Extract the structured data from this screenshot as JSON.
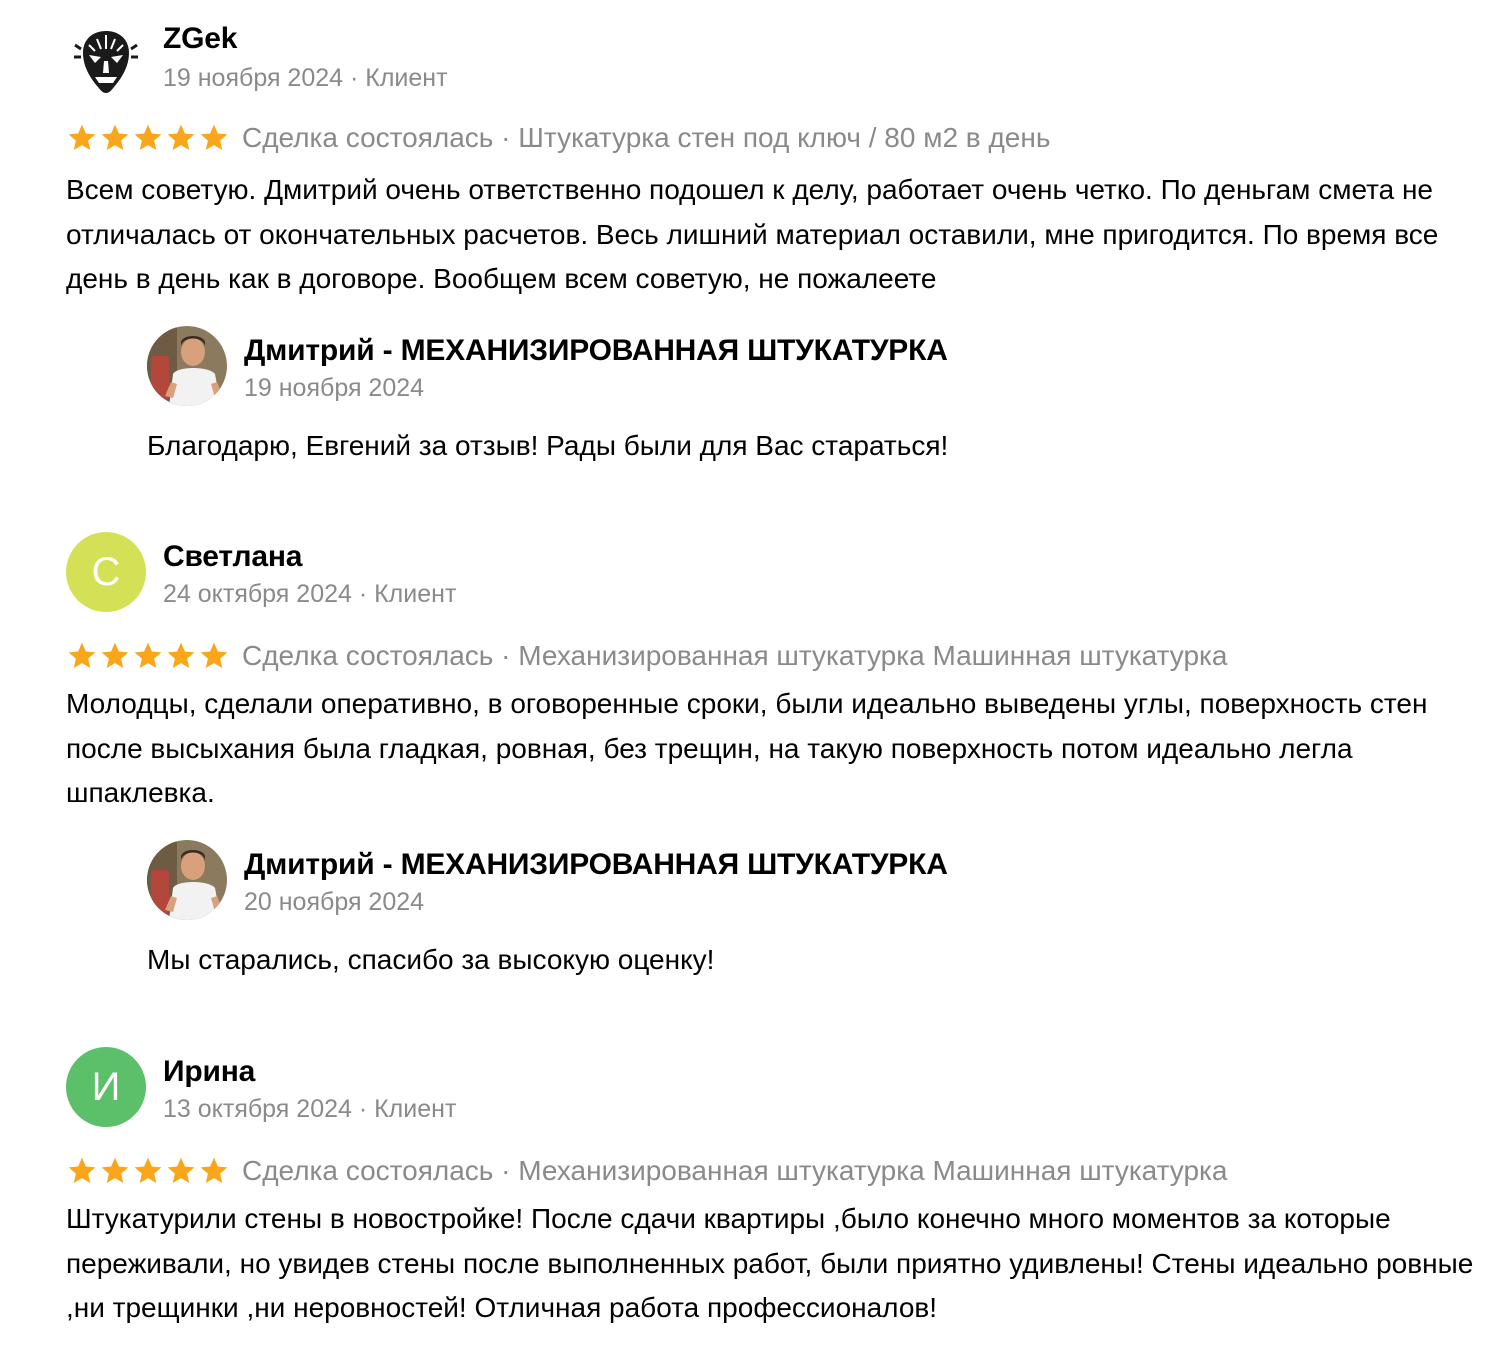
{
  "colors": {
    "star": "#f9a61a",
    "meta": "#8a8a8a",
    "avatar_svetlana": "#d4e157",
    "avatar_irina": "#5cbf6a"
  },
  "icons": {
    "star": "star-icon",
    "mask": "tribal-mask-icon",
    "person_photo": "owner-photo"
  },
  "reviews": [
    {
      "author": "ZGek",
      "meta": "19 ноября 2024 · Клиент",
      "rating": 5,
      "deal": "Сделка состоялась · Штукатурка стен под ключ / 80 м2 в день",
      "text": "Всем советую. Дмитрий очень ответственно подошел к делу, работает очень четко. По деньгам смета не отличалась от окончательных расчетов. Весь лишний материал оставили, мне пригодится. По время все день в день как в договоре. Вообщем всем советую, не пожалеете",
      "reply": {
        "author": "Дмитрий - МЕХАНИЗИРОВАННАЯ ШТУКАТУРКА",
        "date": "19 ноября 2024",
        "text": "Благодарю, Евгений за отзыв! Рады были для Вас стараться!"
      }
    },
    {
      "author": "Светлана",
      "initial": "С",
      "meta": "24 октября 2024 · Клиент",
      "rating": 5,
      "deal": "Сделка состоялась · Механизированная штукатурка Машинная штукатурка",
      "text": "Молодцы, сделали оперативно, в оговоренные сроки, были идеально выведены углы, поверхность стен после высыхания была гладкая, ровная, без трещин, на такую поверхность потом идеально легла шпаклевка.",
      "reply": {
        "author": "Дмитрий - МЕХАНИЗИРОВАННАЯ ШТУКАТУРКА",
        "date": "20 ноября 2024",
        "text": "Мы старались, спасибо за высокую оценку!"
      }
    },
    {
      "author": "Ирина",
      "initial": "И",
      "meta": "13 октября 2024 · Клиент",
      "rating": 5,
      "deal": "Сделка состоялась · Механизированная штукатурка Машинная штукатурка",
      "text": "Штукатурили стены в новостройке! После сдачи квартиры ,было конечно много моментов за которые переживали, но увидев стены после выполненных работ, были приятно удивлены! Стены идеально ровные ,ни трещинки ,ни неровностей! Отличная работа профессионалов!"
    }
  ]
}
